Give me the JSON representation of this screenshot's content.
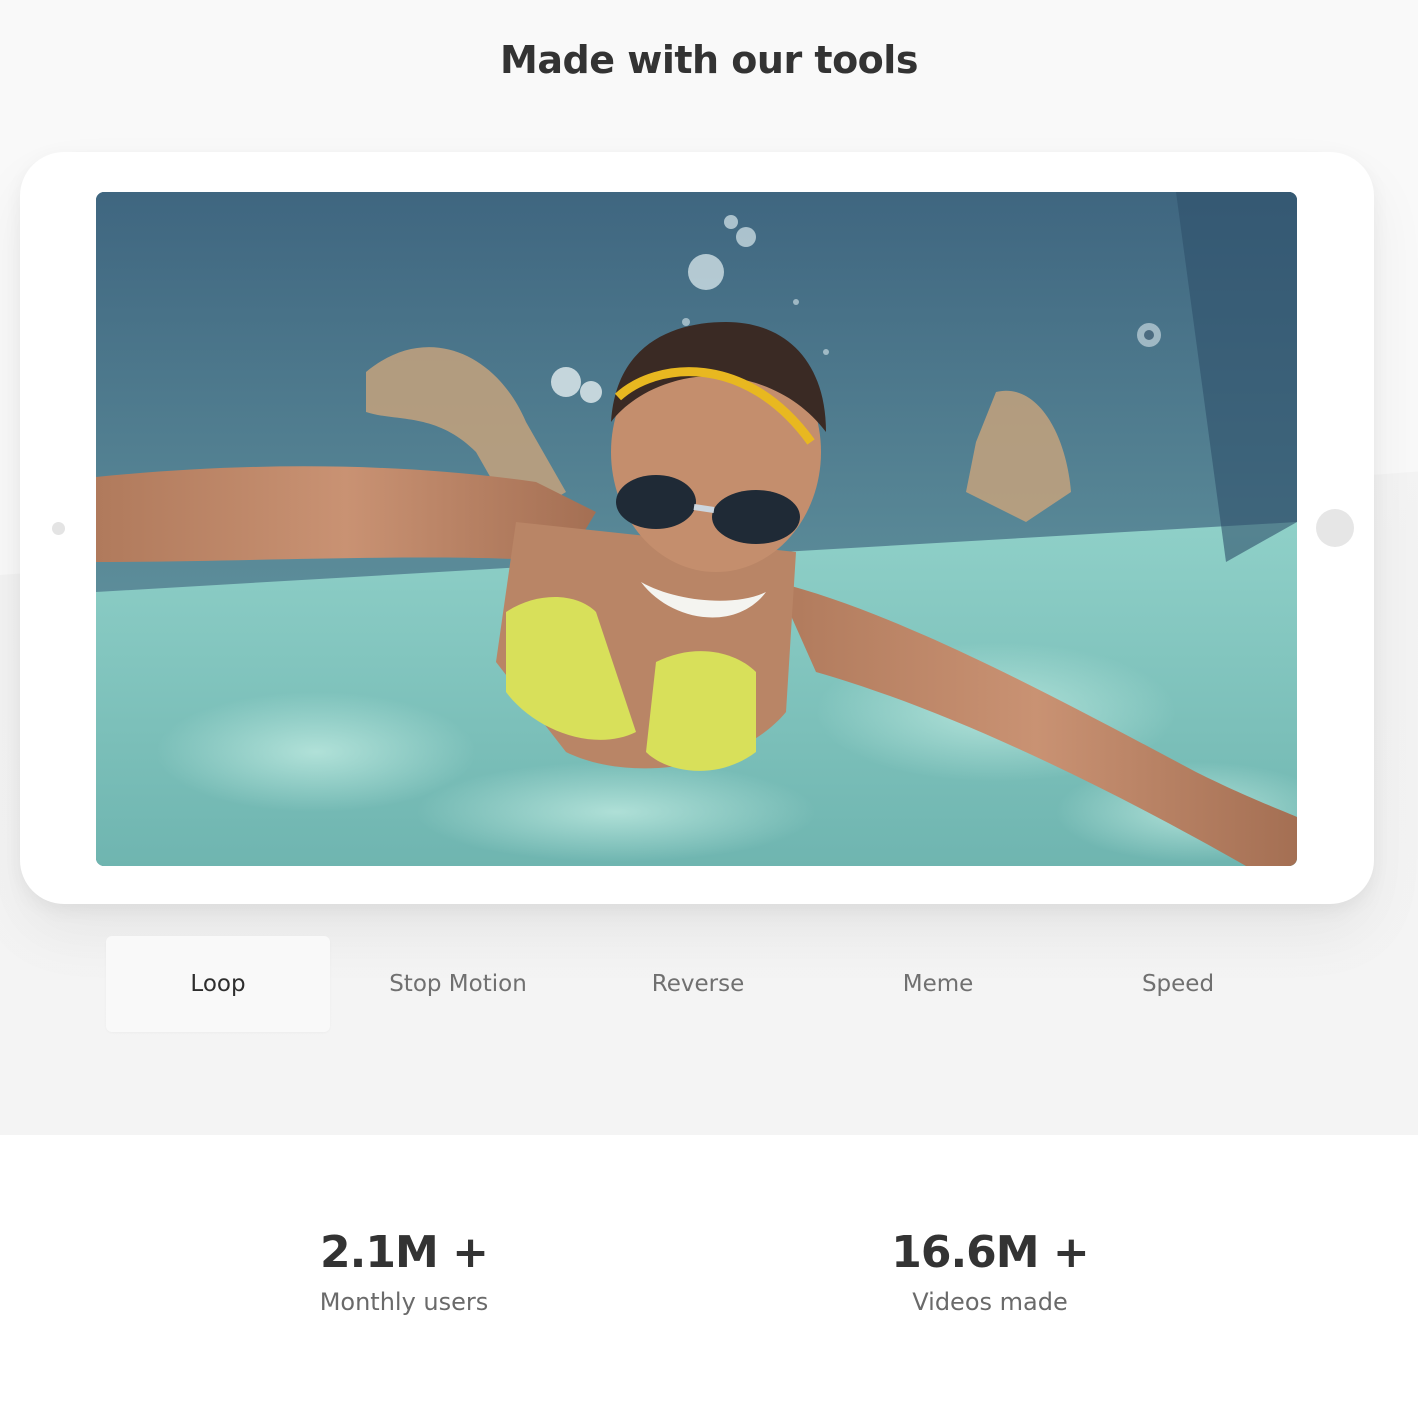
{
  "section": {
    "title": "Made with our tools"
  },
  "device": {
    "screen_content": "underwater-swimmer-video"
  },
  "tabs": {
    "active_index": 0,
    "items": [
      {
        "label": "Loop"
      },
      {
        "label": "Stop Motion"
      },
      {
        "label": "Reverse"
      },
      {
        "label": "Meme"
      },
      {
        "label": "Speed"
      }
    ]
  },
  "stats": {
    "users": {
      "value": "2.1M +",
      "label": "Monthly users"
    },
    "videos": {
      "value": "16.6M +",
      "label": "Videos made"
    }
  },
  "colors": {
    "background": "#f3f3f3",
    "heading": "#333333",
    "tab_inactive": "#707070",
    "tab_active_bg": "#f9f9f9",
    "pool_water": "#7fc4bf",
    "swimsuit": "#d8e05a",
    "headband": "#e8b820"
  }
}
